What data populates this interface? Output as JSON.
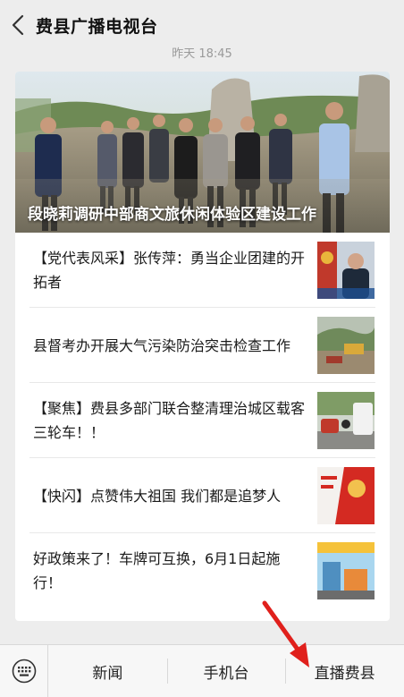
{
  "header": {
    "title": "费县广播电视台",
    "back_icon": "chevron-left-icon"
  },
  "timestamp": "昨天 18:45",
  "article": {
    "hero_title": "段晓莉调研中部商文旅休闲体验区建设工作",
    "items": [
      {
        "title": "【党代表风采】张传萍：勇当企业团建的开拓者",
        "thumb": "party-rep-thumbnail"
      },
      {
        "title": "县督考办开展大气污染防治突击检查工作",
        "thumb": "construction-site-thumbnail"
      },
      {
        "title": "【聚焦】费县多部门联合整清理治城区载客三轮车！！",
        "thumb": "street-vehicles-thumbnail"
      },
      {
        "title": "【快闪】点赞伟大祖国 我们都是追梦人",
        "thumb": "red-banner-thumbnail"
      },
      {
        "title": "好政策来了！车牌可互换，6月1日起施行！",
        "thumb": "city-building-thumbnail"
      }
    ]
  },
  "bottom_menu": {
    "keyboard_icon": "keyboard-icon",
    "items": [
      "新闻",
      "手机台",
      "直播费县"
    ]
  },
  "colors": {
    "background": "#ededed",
    "card": "#ffffff",
    "annotation_arrow": "#e0201c"
  }
}
